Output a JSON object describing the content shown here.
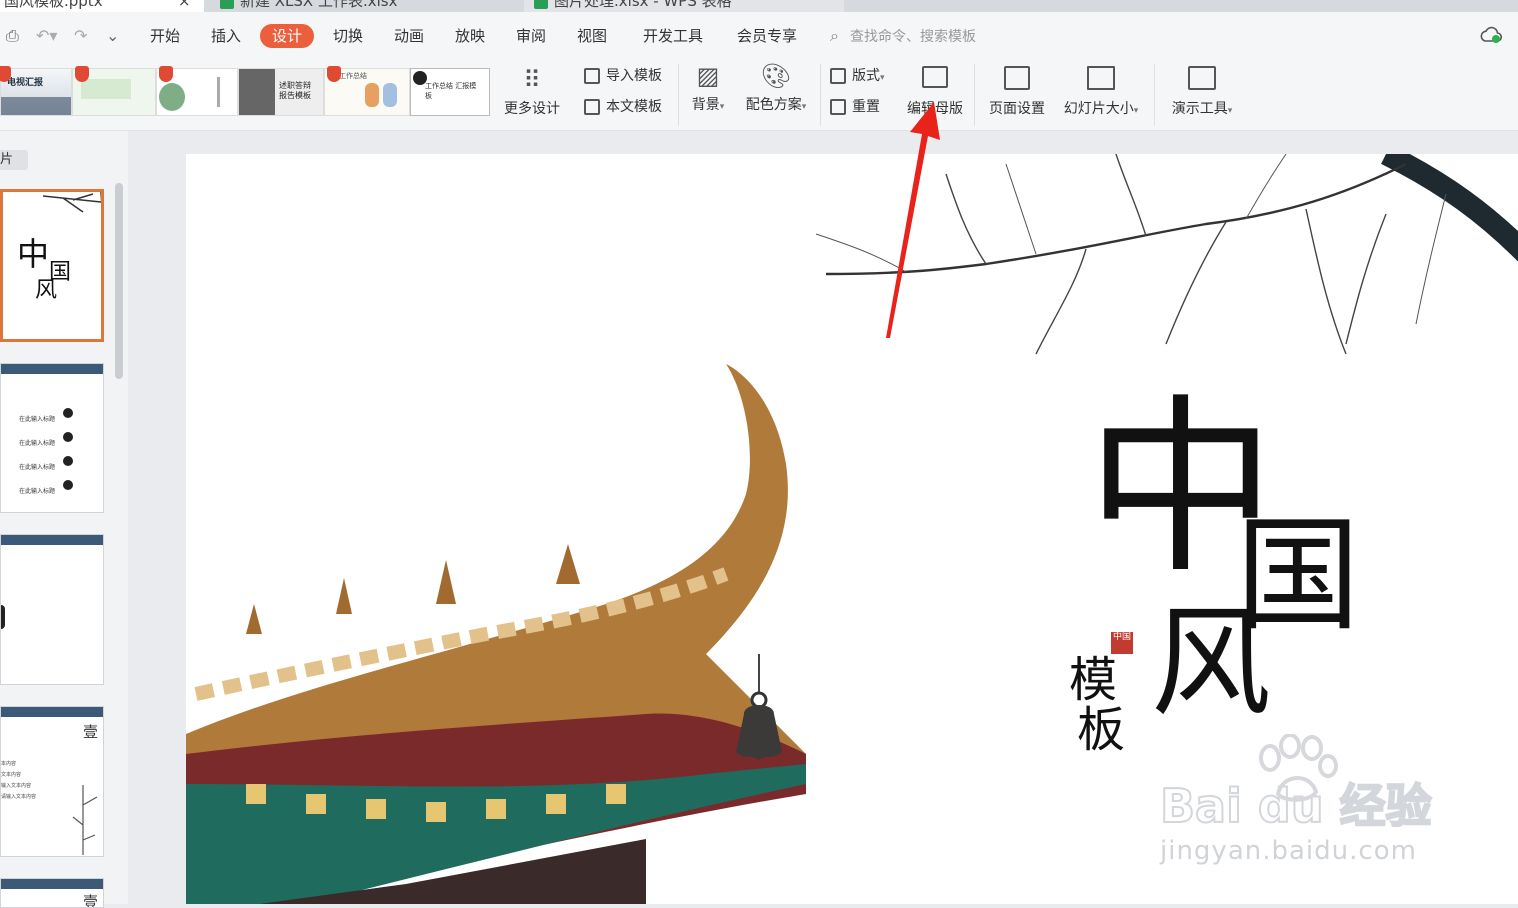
{
  "tabs": [
    {
      "label": "国风模板.pptx"
    },
    {
      "label": "新建 XLSX 工作表.xlsx"
    },
    {
      "label": "图片处理.xlsx - WPS 表格"
    }
  ],
  "menu": {
    "items": [
      "开始",
      "插入",
      "设计",
      "切换",
      "动画",
      "放映",
      "审阅",
      "视图",
      "开发工具",
      "会员专享"
    ],
    "active": "设计",
    "search_placeholder": "查找命令、搜索模板"
  },
  "ribbon": {
    "more_design": "更多设计",
    "import_template": "导入模板",
    "text_template": "本文模板",
    "background": "背景",
    "color_scheme": "配色方案",
    "layout": "版式",
    "reset": "重置",
    "edit_master": "编辑母版",
    "page_setup": "页面设置",
    "slide_size": "幻灯片大小",
    "present_tools": "演示工具"
  },
  "template_thumbs": [
    {
      "caption": "电视汇报"
    },
    {
      "caption": ""
    },
    {
      "caption": ""
    },
    {
      "caption": "述职答辩 报告模板"
    },
    {
      "caption": "工作总结"
    },
    {
      "caption": "工作总结 汇报模板"
    }
  ],
  "left_pane": {
    "label": "片",
    "slides": [
      {
        "title_a": "中",
        "title_b": "国",
        "title_c": "风",
        "selected": true
      },
      {
        "lines": [
          "在此输入标题",
          "在此输入标题",
          "在此输入标题",
          "在此输入标题"
        ]
      },
      {
        "lines": []
      },
      {
        "corner": "壹",
        "lines": [
          "请在此输入标题",
          "本内容",
          "文本内容",
          "输入文本内容",
          "请输入文本内容"
        ]
      },
      {
        "corner": "壹"
      }
    ]
  },
  "slide": {
    "title_zhong": "中",
    "title_guo": "国",
    "title_feng": "风",
    "subtitle_mo": "模",
    "subtitle_ban": "板",
    "seal": "中国"
  },
  "watermark": {
    "brand": "Bai du 经验",
    "url": "jingyan.baidu.com"
  },
  "colors": {
    "accent": "#eb5f3c",
    "selected_border": "#d9783a",
    "arrow": "#e8231c"
  }
}
